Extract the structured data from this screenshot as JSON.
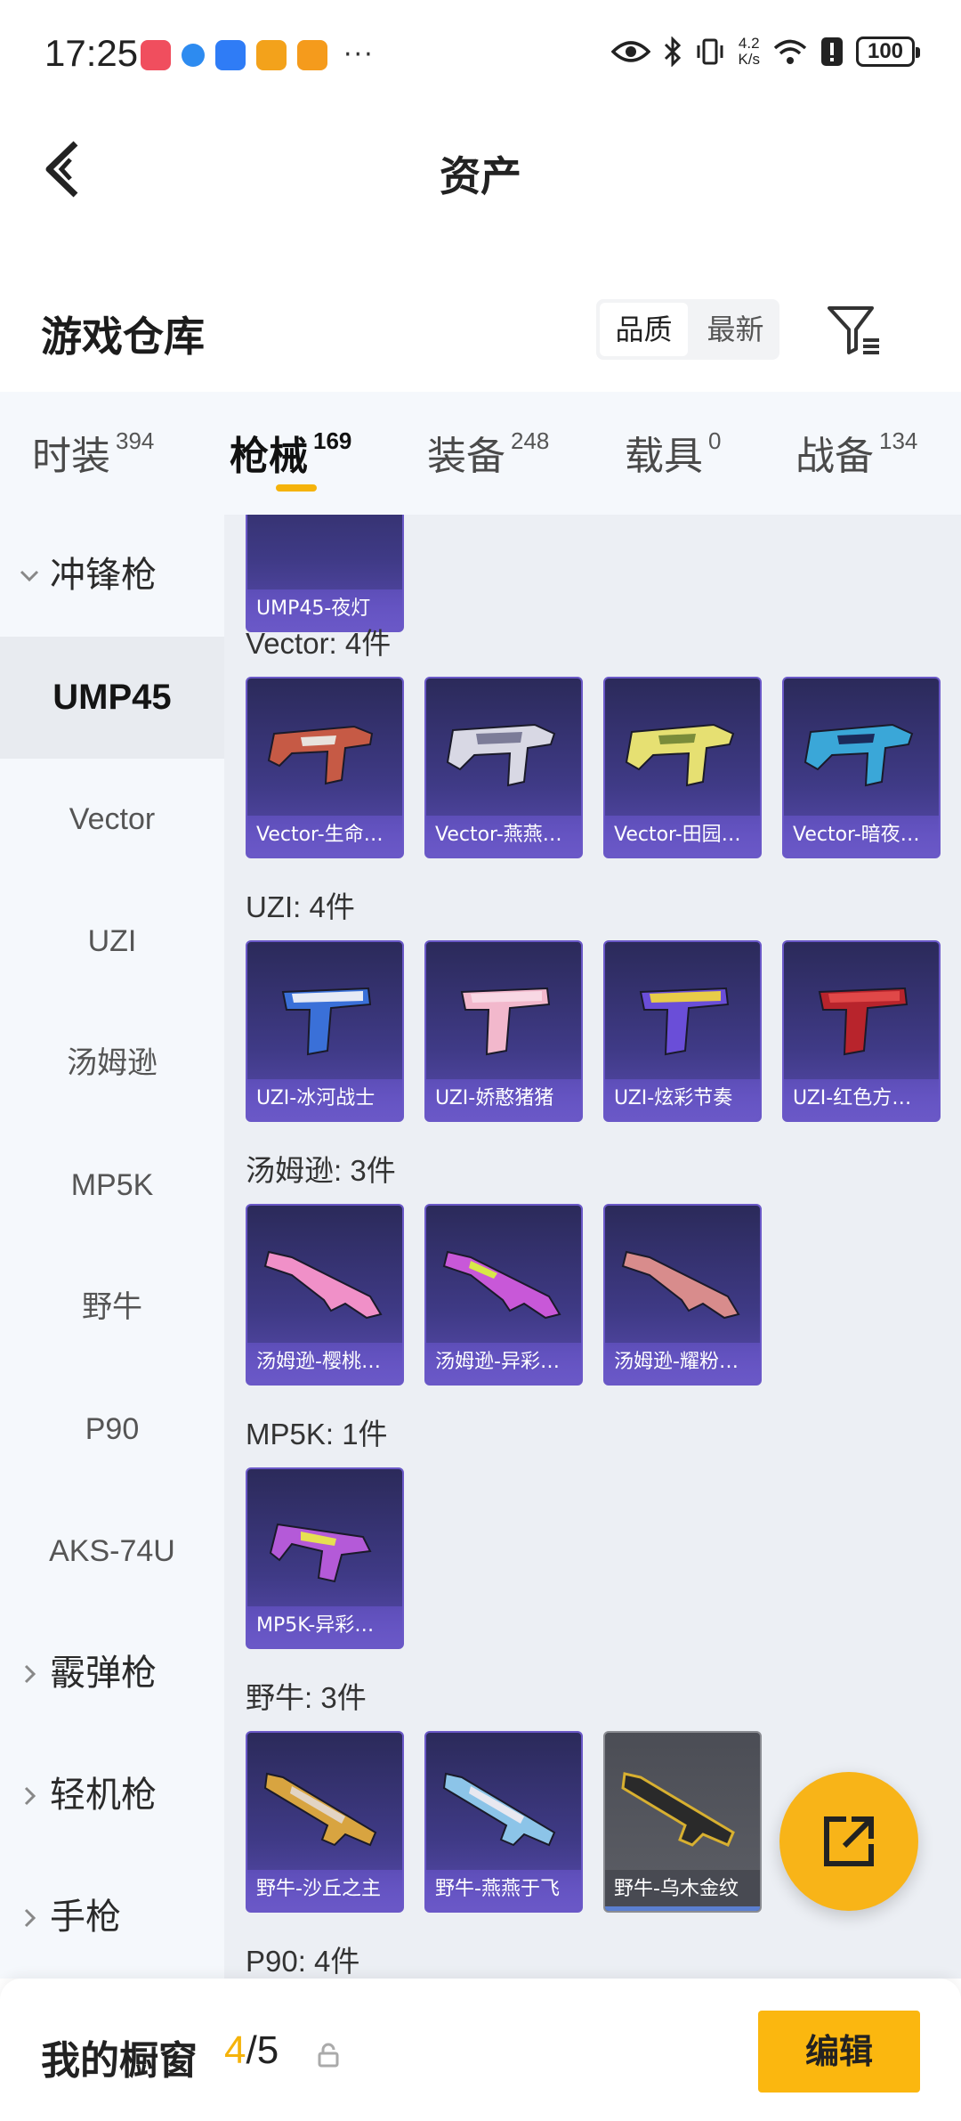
{
  "status_bar": {
    "time": "17:25",
    "dots": "···",
    "network_speed_value": "4.2",
    "network_speed_unit": "K/s",
    "battery": "100",
    "app_icon_colors": [
      "#f04e5e",
      "#2d8bf0",
      "#2f7cf6",
      "#f3a21b",
      "#f59b1c"
    ]
  },
  "nav": {
    "title": "资产",
    "back_icon": "chevron-left-icon"
  },
  "warehouse": {
    "title": "游戏仓库",
    "sort_options": [
      "品质",
      "最新"
    ],
    "active_sort": "品质",
    "filter_icon": "filter-icon"
  },
  "category_tabs": [
    {
      "label": "时装",
      "count": "394"
    },
    {
      "label": "枪械",
      "count": "169"
    },
    {
      "label": "装备",
      "count": "248"
    },
    {
      "label": "载具",
      "count": "0"
    },
    {
      "label": "战备",
      "count": "134"
    }
  ],
  "active_tab": "枪械",
  "accent_color": "#f5b30b",
  "sidebar": {
    "group_smg": "冲锋枪",
    "items": [
      "UMP45",
      "Vector",
      "UZI",
      "汤姆逊",
      "MP5K",
      "野牛",
      "P90",
      "AKS-74U"
    ],
    "active_item": "UMP45",
    "group_shotgun": "霰弹枪",
    "group_lmg": "轻机枪",
    "group_pistol": "手枪"
  },
  "sections": {
    "top_card": "UMP45-夜灯",
    "vector": {
      "title": "Vector: 4件",
      "items": [
        "Vector-生命…",
        "Vector-燕燕…",
        "Vector-田园…",
        "Vector-暗夜…"
      ]
    },
    "uzi": {
      "title": "UZI: 4件",
      "items": [
        "UZI-冰河战士",
        "UZI-娇憨猪猪",
        "UZI-炫彩节奏",
        "UZI-红色方…"
      ]
    },
    "thompson": {
      "title": "汤姆逊: 3件",
      "items": [
        "汤姆逊-樱桃…",
        "汤姆逊-异彩…",
        "汤姆逊-耀粉…"
      ]
    },
    "mp5k": {
      "title": "MP5K: 1件",
      "items": [
        "MP5K-异彩…"
      ]
    },
    "bison": {
      "title": "野牛: 3件",
      "items": [
        "野牛-沙丘之主",
        "野牛-燕燕于飞",
        "野牛-乌木金纹"
      ]
    },
    "p90": {
      "title": "P90: 4件"
    }
  },
  "bottom_bar": {
    "title": "我的橱窗",
    "count_current": "4",
    "count_separator": "/5",
    "edit_label": "编辑"
  },
  "fab_icon": "share-external-icon"
}
